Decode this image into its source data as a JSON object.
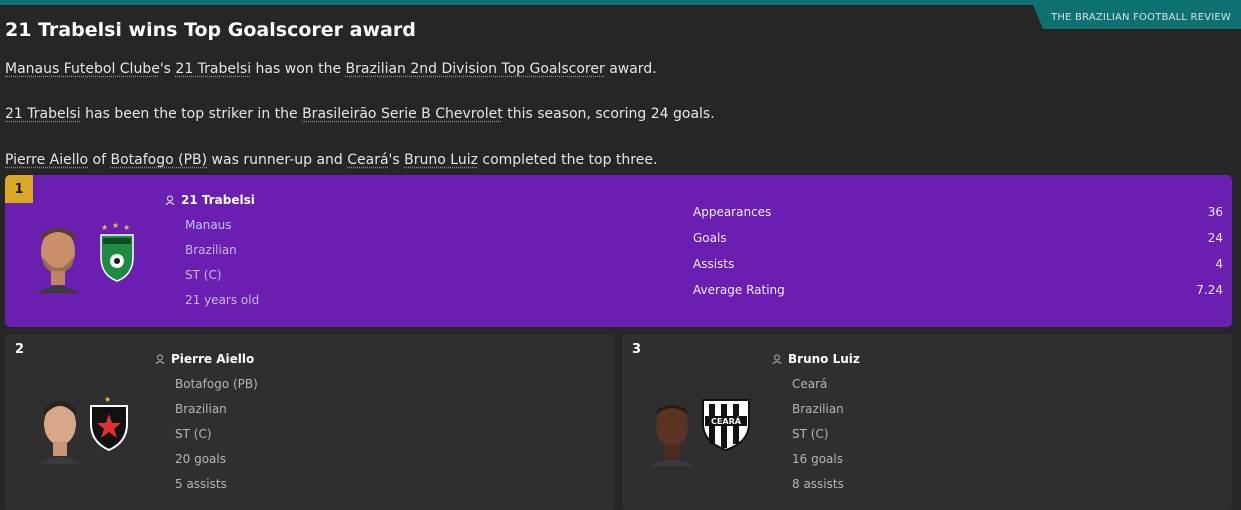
{
  "source": "THE BRAZILIAN FOOTBALL REVIEW",
  "headline": "21 Trabelsi wins Top Goalscorer award",
  "paragraphs": {
    "p1": {
      "club": "Manaus Futebol Clube",
      "poss": "'s ",
      "player": "21 Trabelsi",
      "mid": " has won the ",
      "award": "Brazilian 2nd Division Top Goalscorer",
      "end": " award."
    },
    "p2": {
      "player": "21 Trabelsi",
      "mid": " has been the top striker in the ",
      "league": "Brasileirão Serie B Chevrolet",
      "end": " this season, scoring 24 goals."
    },
    "p3": {
      "runner": "Pierre Aiello",
      "of": " of ",
      "runner_club": "Botafogo (PB)",
      "mid": " was runner-up and ",
      "third_club": "Ceará",
      "poss": "'s ",
      "third": "Bruno Luiz",
      "end": " completed the top three."
    }
  },
  "winner": {
    "rank": "1",
    "name": "21 Trabelsi",
    "club": "Manaus",
    "nationality": "Brazilian",
    "position": "ST (C)",
    "age": "21 years old",
    "stats": [
      {
        "label": "Appearances",
        "value": "36"
      },
      {
        "label": "Goals",
        "value": "24"
      },
      {
        "label": "Assists",
        "value": "4"
      },
      {
        "label": "Average Rating",
        "value": "7.24"
      }
    ]
  },
  "runner_up": {
    "rank": "2",
    "name": "Pierre Aiello",
    "club": "Botafogo (PB)",
    "nationality": "Brazilian",
    "position": "ST (C)",
    "goals": "20 goals",
    "assists": "5 assists"
  },
  "third": {
    "rank": "3",
    "name": "Bruno Luiz",
    "club": "Ceará",
    "nationality": "Brazilian",
    "position": "ST (C)",
    "goals": "16 goals",
    "assists": "8 assists"
  },
  "colors": {
    "accent_teal": "#0e7070",
    "winner_purple": "#6a1fb0",
    "gold": "#d9a926"
  }
}
